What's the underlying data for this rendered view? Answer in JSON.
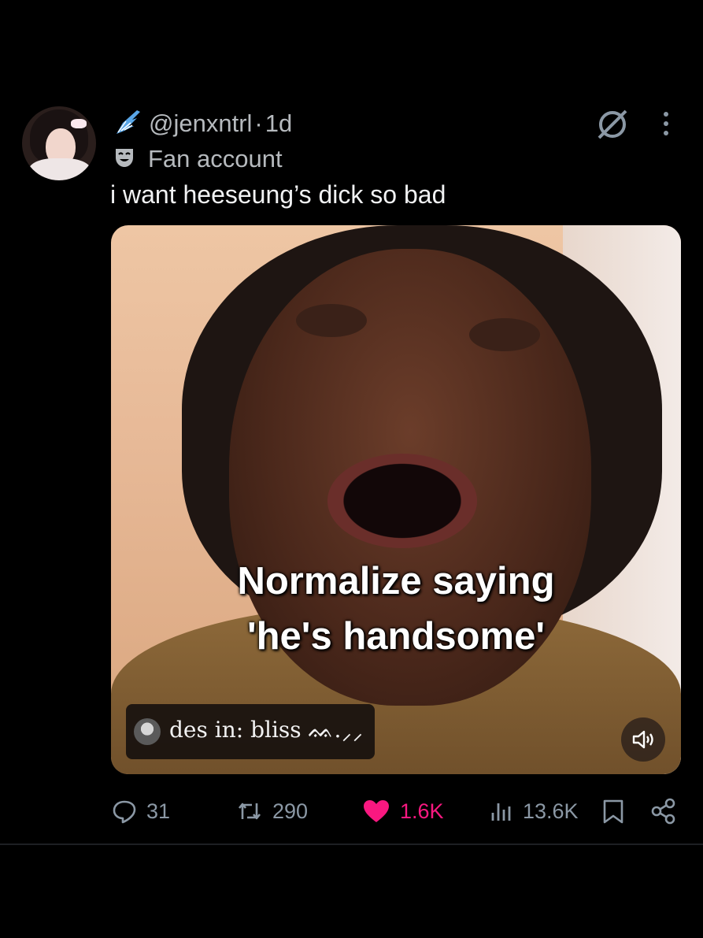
{
  "post": {
    "handle": "@jenxntrl",
    "time": "1d",
    "separator": "·",
    "label": "Fan account",
    "text": "i want heeseung’s dick so bad",
    "media": {
      "caption_line1": "Normalize saying",
      "caption_line2": "'he's handsome'",
      "sound_tag": "des in: bliss ᨐ.⸝⸝"
    },
    "stats": {
      "replies": "31",
      "reposts": "290",
      "likes": "1.6K",
      "views": "13.6K"
    }
  },
  "icons": {
    "wing": "wing-icon",
    "label": "theater-mask-icon",
    "grok": "grok-icon",
    "more": "more-vertical-icon",
    "volume": "volume-icon",
    "reply": "reply-icon",
    "repost": "repost-icon",
    "like": "heart-icon",
    "views": "views-icon",
    "bookmark": "bookmark-icon",
    "share": "share-icon"
  },
  "colors": {
    "background": "#000000",
    "text": "#e7e9ea",
    "muted": "#8b98a5",
    "like": "#f91880",
    "wing": "#5aa7e8"
  }
}
